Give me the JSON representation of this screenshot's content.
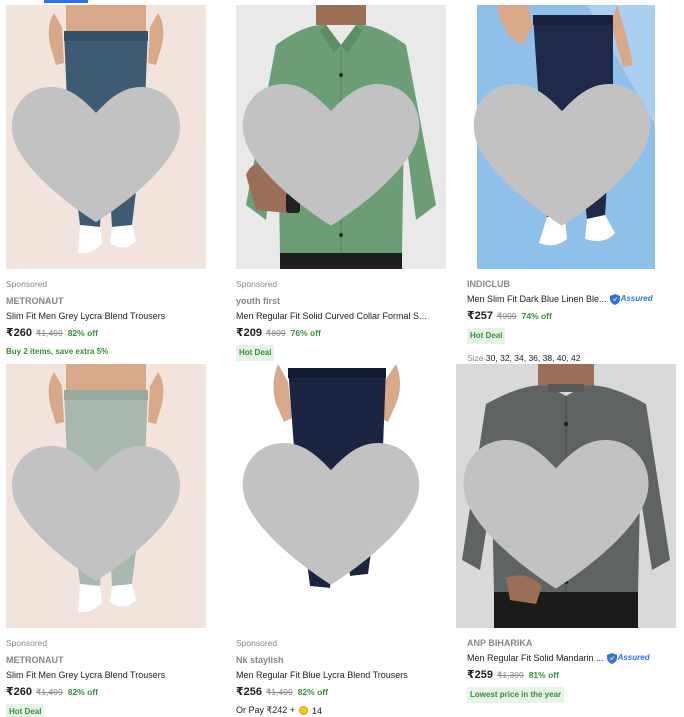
{
  "products": [
    {
      "sponsored": "Sponsored",
      "brand": "METRONAUT",
      "title": "Slim Fit Men Grey Lycra Blend Trousers",
      "price": "₹260",
      "mrp": "₹1,499",
      "off": "82% off",
      "offer": "Buy 2 items, save extra 5%",
      "image": "grey-blue-trousers",
      "colors": {
        "bg": "#f2e4dc",
        "item": "#3f5b73"
      }
    },
    {
      "sponsored": "Sponsored",
      "brand": "youth first",
      "title": "Men Regular Fit Solid Curved Collar Formal S...",
      "price": "₹209",
      "mrp": "₹899",
      "off": "76% off",
      "deal": "Hot Deal",
      "image": "green-shirt",
      "colors": {
        "bg": "#e9e9e9",
        "item": "#6b9e75"
      }
    },
    {
      "brand": "INDICLUB",
      "title": "Men Slim Fit Dark Blue Linen Ble...",
      "assured": "Assured",
      "price": "₹257",
      "mrp": "₹999",
      "off": "74% off",
      "deal": "Hot Deal",
      "sizes_label": "Size",
      "sizes": "30, 32, 34, 36, 38, 40, 42",
      "image": "dark-blue-trousers",
      "colors": {
        "bg": "#8fc0ea",
        "item": "#1f2a4a"
      }
    },
    {
      "sponsored": "Sponsored",
      "brand": "METRONAUT",
      "title": "Slim Fit Men Grey Lycra Blend Trousers",
      "price": "₹260",
      "mrp": "₹1,499",
      "off": "82% off",
      "deal": "Hot Deal",
      "image": "sage-trousers",
      "colors": {
        "bg": "#f2e4dc",
        "item": "#a7b8ae"
      }
    },
    {
      "sponsored": "Sponsored",
      "brand": "Nk staylish",
      "title": "Men Regular Fit Blue Lycra Blend Trousers",
      "price": "₹256",
      "mrp": "₹1,499",
      "off": "82% off",
      "orpay_prefix": "Or Pay ₹242 +",
      "orpay_coins": "14",
      "image": "navy-trousers",
      "colors": {
        "bg": "#ffffff",
        "item": "#1b2440"
      }
    },
    {
      "brand": "ANP BIHARIKA",
      "title": "Men Regular Fit Solid Mandarin ...",
      "assured": "Assured",
      "price": "₹259",
      "mrp": "₹1,399",
      "off": "81% off",
      "deal": "Lowest price in the year",
      "image": "grey-shirt",
      "colors": {
        "bg": "#d9d9d9",
        "item": "#5f6361"
      }
    }
  ],
  "colors": {
    "accent": "#2874f0",
    "discount_green": "#388e3c",
    "muted_text": "#878787",
    "wishlist_heart": "#c2c2c2"
  }
}
